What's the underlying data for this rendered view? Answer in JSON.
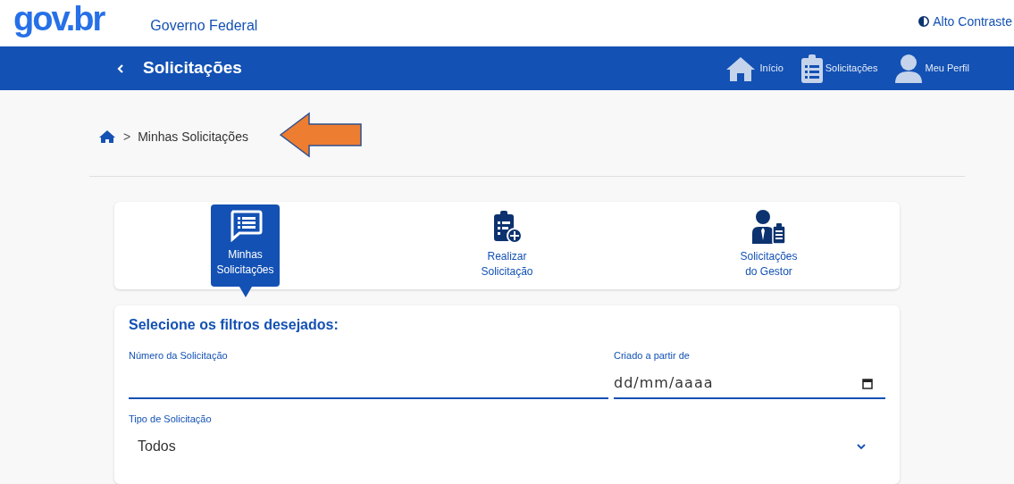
{
  "header": {
    "logo": "gov.br",
    "title": "Governo Federal",
    "contrast_link": "Alto Contraste"
  },
  "navbar": {
    "title": "Solicitações",
    "links": [
      {
        "kind": "home",
        "label": "Início"
      },
      {
        "kind": "list",
        "label": "Solicitações"
      },
      {
        "kind": "profile",
        "label": "Meu Perfil"
      }
    ]
  },
  "breadcrumb": {
    "separator": ">",
    "current": "Minhas Solicitações"
  },
  "tabs": [
    {
      "kind": "chat",
      "line1": "Minhas",
      "line2": "Solicitações",
      "selected": true
    },
    {
      "kind": "add",
      "line1": "Realizar",
      "line2": "Solicitação",
      "selected": false
    },
    {
      "kind": "manager",
      "line1": "Solicitações",
      "line2": "do Gestor",
      "selected": false
    }
  ],
  "filters": {
    "title": "Selecione os filtros desejados:",
    "number_field": {
      "label": "Número da Solicitação"
    },
    "date_field": {
      "label": "Criado a partir de",
      "placeholder": "dd/mm/aaaa"
    },
    "type_select": {
      "label": "Tipo de Solicitação",
      "value": "Todos"
    }
  }
}
